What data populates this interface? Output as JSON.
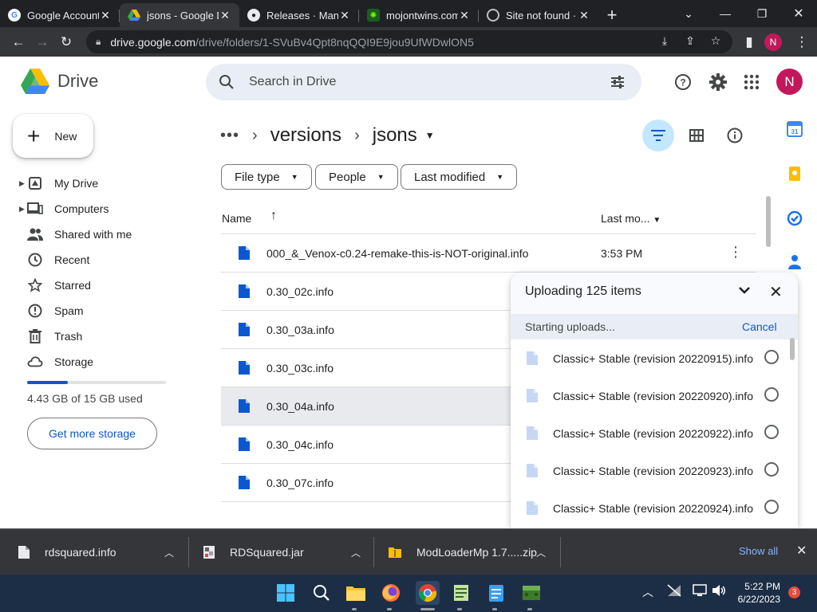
{
  "browser": {
    "tabs": [
      {
        "title": "Google Account",
        "favicon": "google-icon"
      },
      {
        "title": "jsons - Google Drive",
        "favicon": "drive-icon"
      },
      {
        "title": "Releases · Mantle",
        "favicon": "github-icon"
      },
      {
        "title": "mojontwins.com",
        "favicon": "mojon-icon"
      },
      {
        "title": "Site not found ·",
        "favicon": "globe-icon"
      }
    ],
    "url_host": "drive.google.com",
    "url_path": "/drive/folders/1-SVuBv4Qpt8nqQQI9E9jou9UfWDwlON5",
    "profile_initial": "N"
  },
  "drive": {
    "logo_text": "Drive",
    "search_placeholder": "Search in Drive",
    "avatar_initial": "N",
    "new_label": "New",
    "nav": [
      {
        "label": "My Drive",
        "icon": "my-drive-icon",
        "caret": true
      },
      {
        "label": "Computers",
        "icon": "computers-icon",
        "caret": true
      },
      {
        "label": "Shared with me",
        "icon": "shared-icon",
        "caret": false
      },
      {
        "label": "Recent",
        "icon": "clock-icon",
        "caret": false
      },
      {
        "label": "Starred",
        "icon": "star-icon",
        "caret": false
      },
      {
        "label": "Spam",
        "icon": "spam-icon",
        "caret": false
      },
      {
        "label": "Trash",
        "icon": "trash-icon",
        "caret": false
      },
      {
        "label": "Storage",
        "icon": "cloud-icon",
        "caret": false
      }
    ],
    "storage_used_fraction": 0.295,
    "storage_text": "4.43 GB of 15 GB used",
    "get_storage_label": "Get more storage",
    "breadcrumb": {
      "dots": "•••",
      "parent": "versions",
      "current": "jsons"
    },
    "filters": [
      "File type",
      "People",
      "Last modified"
    ],
    "columns": {
      "name": "Name",
      "modified": "Last mo..."
    },
    "files": [
      {
        "name": "000_&_Venox-c0.24-remake-this-is-NOT-original.info",
        "modified": "3:53 PM"
      },
      {
        "name": "0.30_02c.info",
        "modified": ""
      },
      {
        "name": "0.30_03a.info",
        "modified": ""
      },
      {
        "name": "0.30_03c.info",
        "modified": ""
      },
      {
        "name": "0.30_04a.info",
        "modified": ""
      },
      {
        "name": "0.30_04c.info",
        "modified": ""
      },
      {
        "name": "0.30_07c.info",
        "modified": ""
      }
    ]
  },
  "upload": {
    "title": "Uploading 125 items",
    "status": "Starting uploads...",
    "cancel_label": "Cancel",
    "items": [
      "Classic+ Stable (revision 20220915).info",
      "Classic+ Stable (revision 20220920).info",
      "Classic+ Stable (revision 20220922).info",
      "Classic+ Stable (revision 20220923).info",
      "Classic+ Stable (revision 20220924).info"
    ]
  },
  "downloads": {
    "items": [
      "rdsquared.info",
      "RDSquared.jar",
      "ModLoaderMp 1.7.....zip"
    ],
    "show_all": "Show all"
  },
  "taskbar": {
    "time": "5:22 PM",
    "date": "6/22/2023",
    "notification_count": "3"
  },
  "colors": {
    "accent": "#0b57d0",
    "avatar": "#c2185b",
    "selected_bg": "#c2e7ff"
  }
}
